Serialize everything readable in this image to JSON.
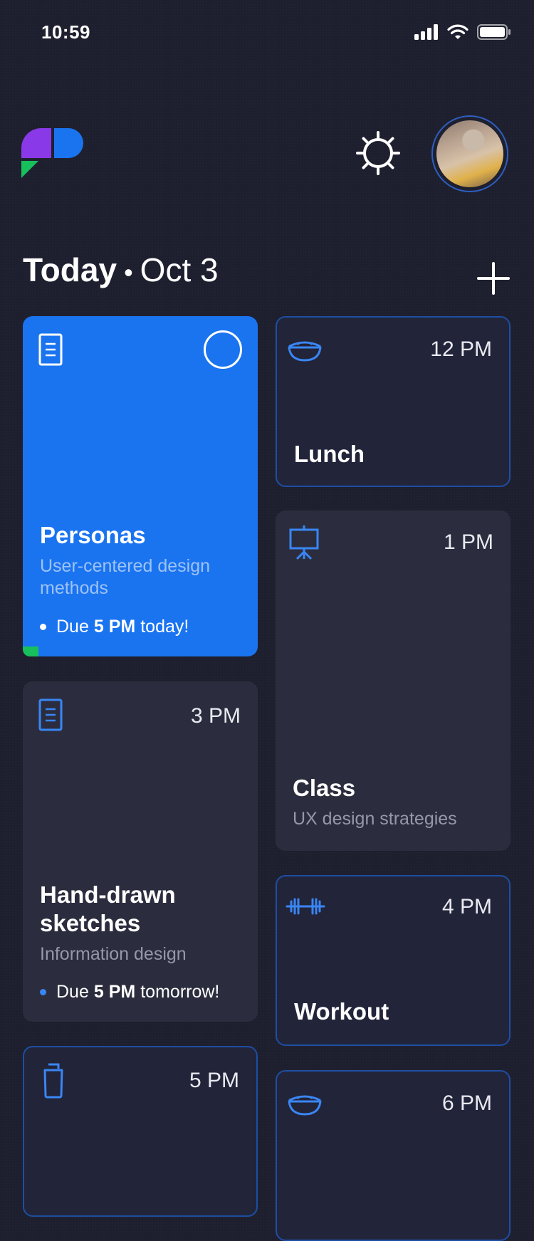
{
  "status": {
    "time": "10:59"
  },
  "header": {
    "title": "Today",
    "separator": "•",
    "date": "Oct 3"
  },
  "colors": {
    "background": "#1e1f2e",
    "accent_blue": "#1a74f0",
    "outline_blue": "#1d4ea3",
    "green": "#17c05c",
    "purple": "#8a39e8"
  },
  "cards": {
    "personas": {
      "icon": "document-icon",
      "title": "Personas",
      "subtitle_line1": "User-centered design",
      "subtitle_line2": "methods",
      "due_prefix": "Due",
      "due_time": "5 PM",
      "due_suffix": "today!"
    },
    "lunch": {
      "icon": "bowl-icon",
      "time": "12 PM",
      "title": "Lunch"
    },
    "class": {
      "icon": "presentation-board-icon",
      "time": "1 PM",
      "title": "Class",
      "subtitle": "UX design strategies"
    },
    "sketches": {
      "icon": "document-icon",
      "time": "3 PM",
      "title_line1": "Hand-drawn",
      "title_line2": "sketches",
      "subtitle": "Information design",
      "due_prefix": "Due",
      "due_time": "5 PM",
      "due_suffix": "tomorrow!"
    },
    "workout": {
      "icon": "dumbbell-icon",
      "time": "4 PM",
      "title": "Workout"
    },
    "card5pm": {
      "icon": "cup-icon",
      "time": "5 PM"
    },
    "card6pm": {
      "icon": "bowl-icon",
      "time": "6 PM"
    }
  }
}
